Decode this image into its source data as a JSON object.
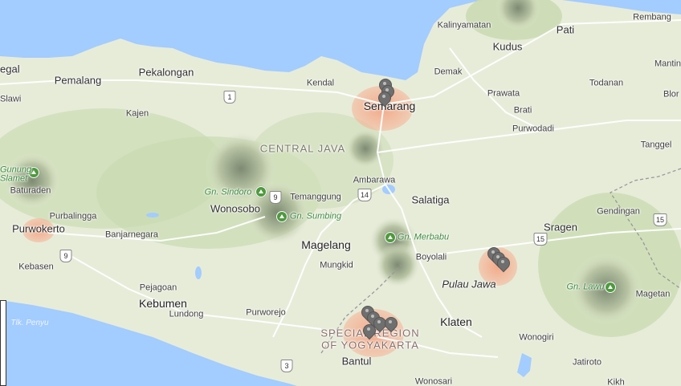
{
  "map": {
    "labels": {
      "region_central_java": "CENTRAL JAVA",
      "region_yogya_1": "SPECIAL REGION",
      "region_yogya_2": "OF YOGYAKARTA",
      "semarang": "Semarang",
      "kalinyamatan": "Kalinyamatan",
      "kudus": "Kudus",
      "pati": "Pati",
      "rembang": "Rembang",
      "mantin": "Mantin",
      "demak": "Demak",
      "todanan": "Todanan",
      "blora": "Blor",
      "prawata": "Prawata",
      "brati": "Brati",
      "purwodadi": "Purwodadi",
      "tanggel": "Tanggel",
      "kendal": "Kendal",
      "pekalongan": "Pekalongan",
      "pemalang": "Pemalang",
      "tegal": "egal",
      "slawi": "Slawi",
      "kajen": "Kajen",
      "baturaden": "Baturaden",
      "purbalingga": "Purbalingga",
      "purwokerto": "Purwokerto",
      "banjarnegara": "Banjarnegara",
      "kebasen": "Kebasen",
      "wonosobo": "Wonosobo",
      "temanggung": "Temanggung",
      "ambarawa": "Ambarawa",
      "salatiga": "Salatiga",
      "magelang": "Magelang",
      "mungkid": "Mungkid",
      "boyolali": "Boyolali",
      "sragen": "Sragen",
      "gendingan": "Gendingan",
      "pulau_jawa": "Pulau Jawa",
      "magetan": "Magetan",
      "kebumen": "Kebumen",
      "pejagoan": "Pejagoan",
      "lundong": "Lundong",
      "purworejo": "Purworejo",
      "klaten": "Klaten",
      "bantul": "Bantul",
      "wonogiri": "Wonogiri",
      "jatiroto": "Jatiroto",
      "wonosari": "Wonosari",
      "tlk_penyu": "Tlk. Penyu",
      "kikh": "Kikh"
    },
    "mountains": {
      "slamet_1": "Gunung",
      "slamet_2": "Slamet",
      "sindoro": "Gn. Sindoro",
      "sumbing": "Gn. Sumbing",
      "merbabu": "Gn. Merbabu",
      "lawu": "Gn. Lawu"
    },
    "road_shields": {
      "r1": "1",
      "r9a": "9",
      "r9b": "9",
      "r14": "14",
      "r15a": "15",
      "r15b": "15",
      "r3": "3"
    },
    "colors": {
      "sea": "#a3ccff",
      "land": "#e7ecd9",
      "urban": "#f5b79a",
      "forest": "#c8ddb0",
      "road": "#ffffff",
      "park": "#4e9a3e",
      "marker": "#6f6f6f"
    }
  }
}
